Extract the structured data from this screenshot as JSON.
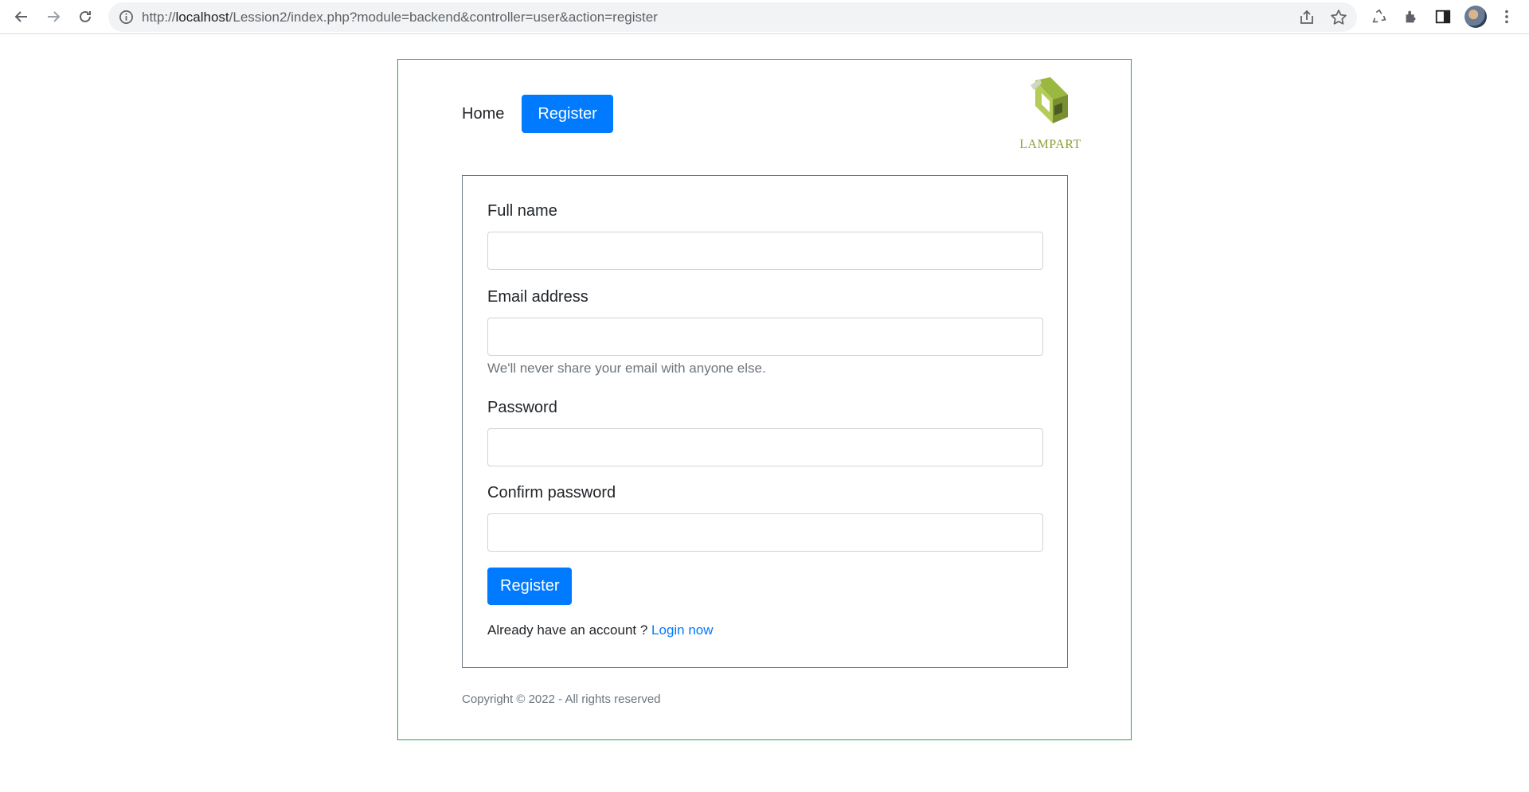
{
  "browser": {
    "url_scheme": "http://",
    "url_host": "localhost",
    "url_path": "/Lession2/index.php?module=backend&controller=user&action=register"
  },
  "nav": {
    "home_label": "Home",
    "register_label": "Register"
  },
  "logo": {
    "text": "LAMPART"
  },
  "form": {
    "fullname_label": "Full name",
    "fullname_value": "",
    "email_label": "Email address",
    "email_value": "",
    "email_help": "We'll never share your email with anyone else.",
    "password_label": "Password",
    "password_value": "",
    "confirm_label": "Confirm password",
    "confirm_value": "",
    "submit_label": "Register",
    "login_prompt": "Already have an account ? ",
    "login_link": "Login now"
  },
  "footer": {
    "copyright": "Copyright © 2022 - All rights reserved"
  },
  "colors": {
    "primary": "#007bff",
    "frame_border": "#28a745",
    "card_border": "#6c757d",
    "logo_green": "#8aa33a"
  }
}
